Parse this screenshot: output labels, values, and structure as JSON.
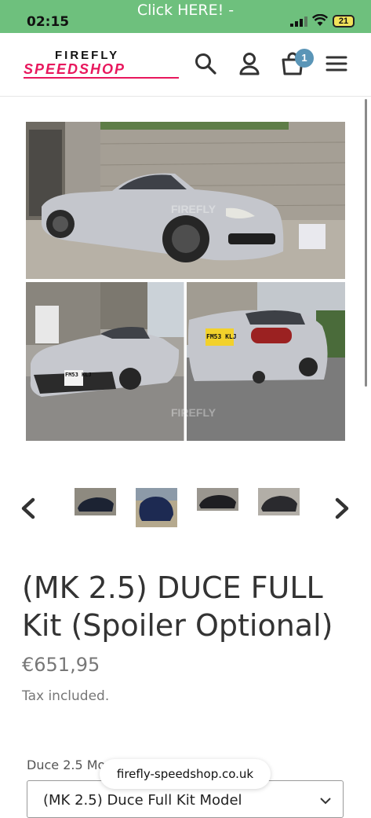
{
  "status_bar": {
    "time": "02:15",
    "banner": "Click HERE! -",
    "battery": "21",
    "icons": [
      "signal-icon",
      "wifi-icon",
      "battery-icon"
    ]
  },
  "header": {
    "logo_top": "FIREFLY",
    "logo_bottom": "SPEEDSHOP",
    "cart_count": "1",
    "icons": [
      "search-icon",
      "account-icon",
      "cart-icon",
      "menu-icon"
    ],
    "brand_color": "#e8175d"
  },
  "gallery": {
    "watermark": "FIREFLY",
    "plates": [
      "FM53 KLJ",
      "FM53 KLJ"
    ],
    "thumbnail_count": 4,
    "icons": [
      "chevron-left-icon",
      "chevron-right-icon"
    ]
  },
  "product": {
    "title": "(MK 2.5) DUCE FULL Kit (Spoiler Optional)",
    "price": "€651,95",
    "tax_note": "Tax included.",
    "variant_label": "Duce 2.5 Mo",
    "variant_selected": "(MK 2.5) Duce Full Kit Model"
  },
  "browser": {
    "url": "firefly-speedshop.co.uk"
  }
}
